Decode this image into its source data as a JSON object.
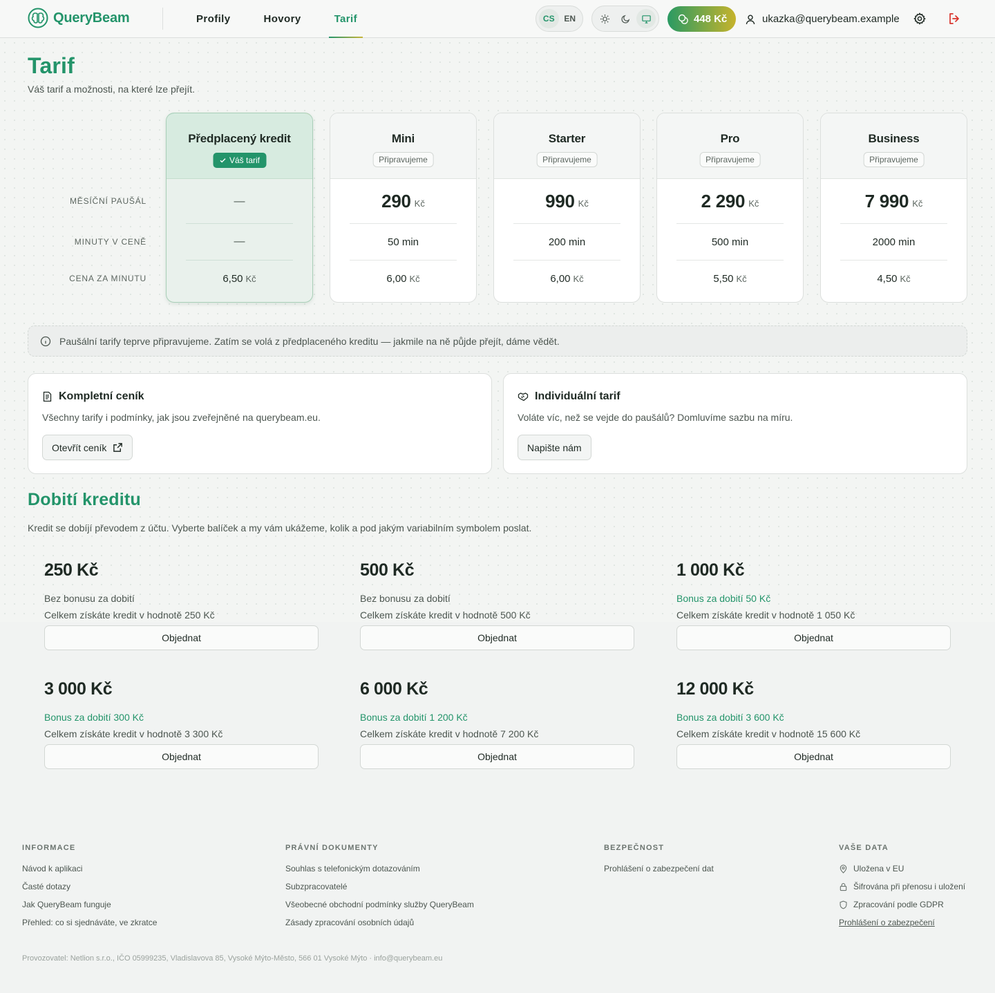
{
  "header": {
    "logo_text": "QueryBeam",
    "nav": [
      {
        "label": "Profily",
        "active": false
      },
      {
        "label": "Hovory",
        "active": false
      },
      {
        "label": "Tarif",
        "active": true
      }
    ],
    "languages": [
      "CS",
      "EN"
    ],
    "active_language": "CS",
    "theme_options": [
      "sun-icon",
      "moon-icon",
      "monitor-icon"
    ],
    "active_theme": "monitor-icon",
    "credit": "448 Kč",
    "user_email": "ukazka@querybeam.example"
  },
  "page": {
    "title": "Tarif",
    "subtitle": "Váš tarif a možnosti, na které lze přejít."
  },
  "plans": {
    "row_labels": {
      "monthly": "Měsíční paušál",
      "minutes": "Minuty v ceně",
      "rate": "Cena za minutu"
    },
    "soon_label": "Připravujeme",
    "current_label": "Váš tarif",
    "currency": "Kč",
    "items": [
      {
        "name": "Předplacený kredit",
        "current": true,
        "monthly": "—",
        "minutes": "—",
        "rate": "6,50"
      },
      {
        "name": "Mini",
        "current": false,
        "monthly": "290",
        "minutes": "50 min",
        "rate": "6,00"
      },
      {
        "name": "Starter",
        "current": false,
        "monthly": "990",
        "minutes": "200 min",
        "rate": "6,00"
      },
      {
        "name": "Pro",
        "current": false,
        "monthly": "2 290",
        "minutes": "500 min",
        "rate": "5,50"
      },
      {
        "name": "Business",
        "current": false,
        "monthly": "7 990",
        "minutes": "2000 min",
        "rate": "4,50"
      }
    ]
  },
  "info_banner": "Paušální tarify teprve připravujeme. Zatím se volá z předplaceného kreditu — jakmile na ně půjde přejít, dáme vědět.",
  "cards": {
    "pricing": {
      "title": "Kompletní ceník",
      "desc": "Všechny tarify i podmínky, jak jsou zveřejněné na querybeam.eu.",
      "button": "Otevřít ceník"
    },
    "custom": {
      "title": "Individuální tarif",
      "desc": "Voláte víc, než se vejde do paušálů? Domluvíme sazbu na míru.",
      "button": "Napište nám"
    }
  },
  "topup": {
    "title": "Dobití kreditu",
    "subtitle": "Kredit se dobíjí převodem z účtu. Vyberte balíček a my vám ukážeme, kolik a pod jakým variabilním symbolem poslat.",
    "order_label": "Objednat",
    "packages": [
      {
        "amount": "250 Kč",
        "bonus": "Bez bonusu za dobití",
        "has_bonus": false,
        "total": "Celkem získáte kredit v hodnotě 250 Kč"
      },
      {
        "amount": "500 Kč",
        "bonus": "Bez bonusu za dobití",
        "has_bonus": false,
        "total": "Celkem získáte kredit v hodnotě 500 Kč"
      },
      {
        "amount": "1 000 Kč",
        "bonus": "Bonus za dobití 50 Kč",
        "has_bonus": true,
        "total": "Celkem získáte kredit v hodnotě 1 050 Kč"
      },
      {
        "amount": "3 000 Kč",
        "bonus": "Bonus za dobití 300 Kč",
        "has_bonus": true,
        "total": "Celkem získáte kredit v hodnotě 3 300 Kč"
      },
      {
        "amount": "6 000 Kč",
        "bonus": "Bonus za dobití 1 200 Kč",
        "has_bonus": true,
        "total": "Celkem získáte kredit v hodnotě 7 200 Kč"
      },
      {
        "amount": "12 000 Kč",
        "bonus": "Bonus za dobití 3 600 Kč",
        "has_bonus": true,
        "total": "Celkem získáte kredit v hodnotě 15 600 Kč"
      }
    ]
  },
  "footer": {
    "info": {
      "title": "Informace",
      "links": [
        "Návod k aplikaci",
        "Časté dotazy",
        "Jak QueryBeam funguje",
        "Přehled: co si sjednáváte, ve zkratce"
      ]
    },
    "legal": {
      "title": "Právní dokumenty",
      "links": [
        "Souhlas s telefonickým dotazováním",
        "Subzpracovatelé",
        "Všeobecné obchodní podmínky služby QueryBeam",
        "Zásady zpracování osobních údajů"
      ]
    },
    "security": {
      "title": "Bezpečnost",
      "links": [
        "Prohlášení o zabezpečení dat"
      ]
    },
    "data": {
      "title": "Vaše data",
      "items": [
        {
          "icon": "location-pin-icon",
          "label": "Uložena v EU"
        },
        {
          "icon": "lock-icon",
          "label": "Šifrována při přenosu i uložení"
        },
        {
          "icon": "shield-icon",
          "label": "Zpracování podle GDPR"
        }
      ],
      "link": "Prohlášení o zabezpečení"
    },
    "operator": "Provozovatel: Netlion s.r.o., IČO 05999235, Vladislavova 85, Vysoké Mýto-Město, 566 01 Vysoké Mýto · info@querybeam.eu"
  },
  "colors": {
    "brand": "#23946a",
    "accent_gold": "#c8b53a",
    "logout": "#d9342b"
  }
}
